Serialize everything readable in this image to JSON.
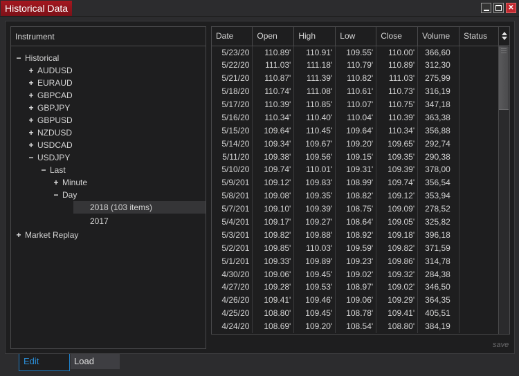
{
  "window": {
    "title": "Historical Data",
    "buttons": {
      "minimize": "minimize",
      "maximize": "maximize",
      "close": "✕"
    }
  },
  "instrument_panel": {
    "header": "Instrument",
    "tree": [
      {
        "label": "Historical",
        "toggle": "−",
        "depth": 0
      },
      {
        "label": "AUDUSD",
        "toggle": "+",
        "depth": 1
      },
      {
        "label": "EURAUD",
        "toggle": "+",
        "depth": 1
      },
      {
        "label": "GBPCAD",
        "toggle": "+",
        "depth": 1
      },
      {
        "label": "GBPJPY",
        "toggle": "+",
        "depth": 1
      },
      {
        "label": "GBPUSD",
        "toggle": "+",
        "depth": 1
      },
      {
        "label": "NZDUSD",
        "toggle": "+",
        "depth": 1
      },
      {
        "label": "USDCAD",
        "toggle": "+",
        "depth": 1
      },
      {
        "label": "USDJPY",
        "toggle": "−",
        "depth": 1
      },
      {
        "label": "Last",
        "toggle": "−",
        "depth": 2
      },
      {
        "label": "Minute",
        "toggle": "+",
        "depth": 3
      },
      {
        "label": "Day",
        "toggle": "−",
        "depth": 3
      },
      {
        "label": "2018 (103 items)",
        "toggle": "",
        "depth": 4,
        "selected": true
      },
      {
        "label": "2017",
        "toggle": "",
        "depth": 4
      },
      {
        "label": "Market Replay",
        "toggle": "+",
        "depth": 0
      }
    ]
  },
  "grid": {
    "columns": [
      "Date",
      "Open",
      "High",
      "Low",
      "Close",
      "Volume",
      "Status"
    ],
    "rows": [
      [
        "5/23/20",
        "110.89'",
        "110.91'",
        "109.55'",
        "110.00'",
        "366,60",
        ""
      ],
      [
        "5/22/20",
        "111.03'",
        "111.18'",
        "110.79'",
        "110.89'",
        "312,30",
        ""
      ],
      [
        "5/21/20",
        "110.87'",
        "111.39'",
        "110.82'",
        "111.03'",
        "275,99",
        ""
      ],
      [
        "5/18/20",
        "110.74'",
        "111.08'",
        "110.61'",
        "110.73'",
        "316,19",
        ""
      ],
      [
        "5/17/20",
        "110.39'",
        "110.85'",
        "110.07'",
        "110.75'",
        "347,18",
        ""
      ],
      [
        "5/16/20",
        "110.34'",
        "110.40'",
        "110.04'",
        "110.39'",
        "363,38",
        ""
      ],
      [
        "5/15/20",
        "109.64'",
        "110.45'",
        "109.64'",
        "110.34'",
        "356,88",
        ""
      ],
      [
        "5/14/20",
        "109.34'",
        "109.67'",
        "109.20'",
        "109.65'",
        "292,74",
        ""
      ],
      [
        "5/11/20",
        "109.38'",
        "109.56'",
        "109.15'",
        "109.35'",
        "290,38",
        ""
      ],
      [
        "5/10/20",
        "109.74'",
        "110.01'",
        "109.31'",
        "109.39'",
        "378,00",
        ""
      ],
      [
        "5/9/201",
        "109.12'",
        "109.83'",
        "108.99'",
        "109.74'",
        "356,54",
        ""
      ],
      [
        "5/8/201",
        "109.08'",
        "109.35'",
        "108.82'",
        "109.12'",
        "353,94",
        ""
      ],
      [
        "5/7/201",
        "109.10'",
        "109.39'",
        "108.75'",
        "109.09'",
        "278,52",
        ""
      ],
      [
        "5/4/201",
        "109.17'",
        "109.27'",
        "108.64'",
        "109.05'",
        "325,82",
        ""
      ],
      [
        "5/3/201",
        "109.82'",
        "109.88'",
        "108.92'",
        "109.18'",
        "396,18",
        ""
      ],
      [
        "5/2/201",
        "109.85'",
        "110.03'",
        "109.59'",
        "109.82'",
        "371,59",
        ""
      ],
      [
        "5/1/201",
        "109.33'",
        "109.89'",
        "109.23'",
        "109.86'",
        "314,78",
        ""
      ],
      [
        "4/30/20",
        "109.06'",
        "109.45'",
        "109.02'",
        "109.32'",
        "284,38",
        ""
      ],
      [
        "4/27/20",
        "109.28'",
        "109.53'",
        "108.97'",
        "109.02'",
        "346,50",
        ""
      ],
      [
        "4/26/20",
        "109.41'",
        "109.46'",
        "109.06'",
        "109.29'",
        "364,35",
        ""
      ],
      [
        "4/25/20",
        "108.80'",
        "109.45'",
        "108.78'",
        "109.41'",
        "405,51",
        ""
      ],
      [
        "4/24/20",
        "108.69'",
        "109.20'",
        "108.54'",
        "108.80'",
        "384,19",
        ""
      ]
    ]
  },
  "footer": {
    "save_label": "save",
    "tabs": [
      {
        "label": "Edit",
        "active": true
      },
      {
        "label": "Load",
        "active": false
      }
    ]
  },
  "colors": {
    "title_accent": "#a4171f",
    "active_tab": "#2b8fd8",
    "background": "#1e1e1f"
  }
}
